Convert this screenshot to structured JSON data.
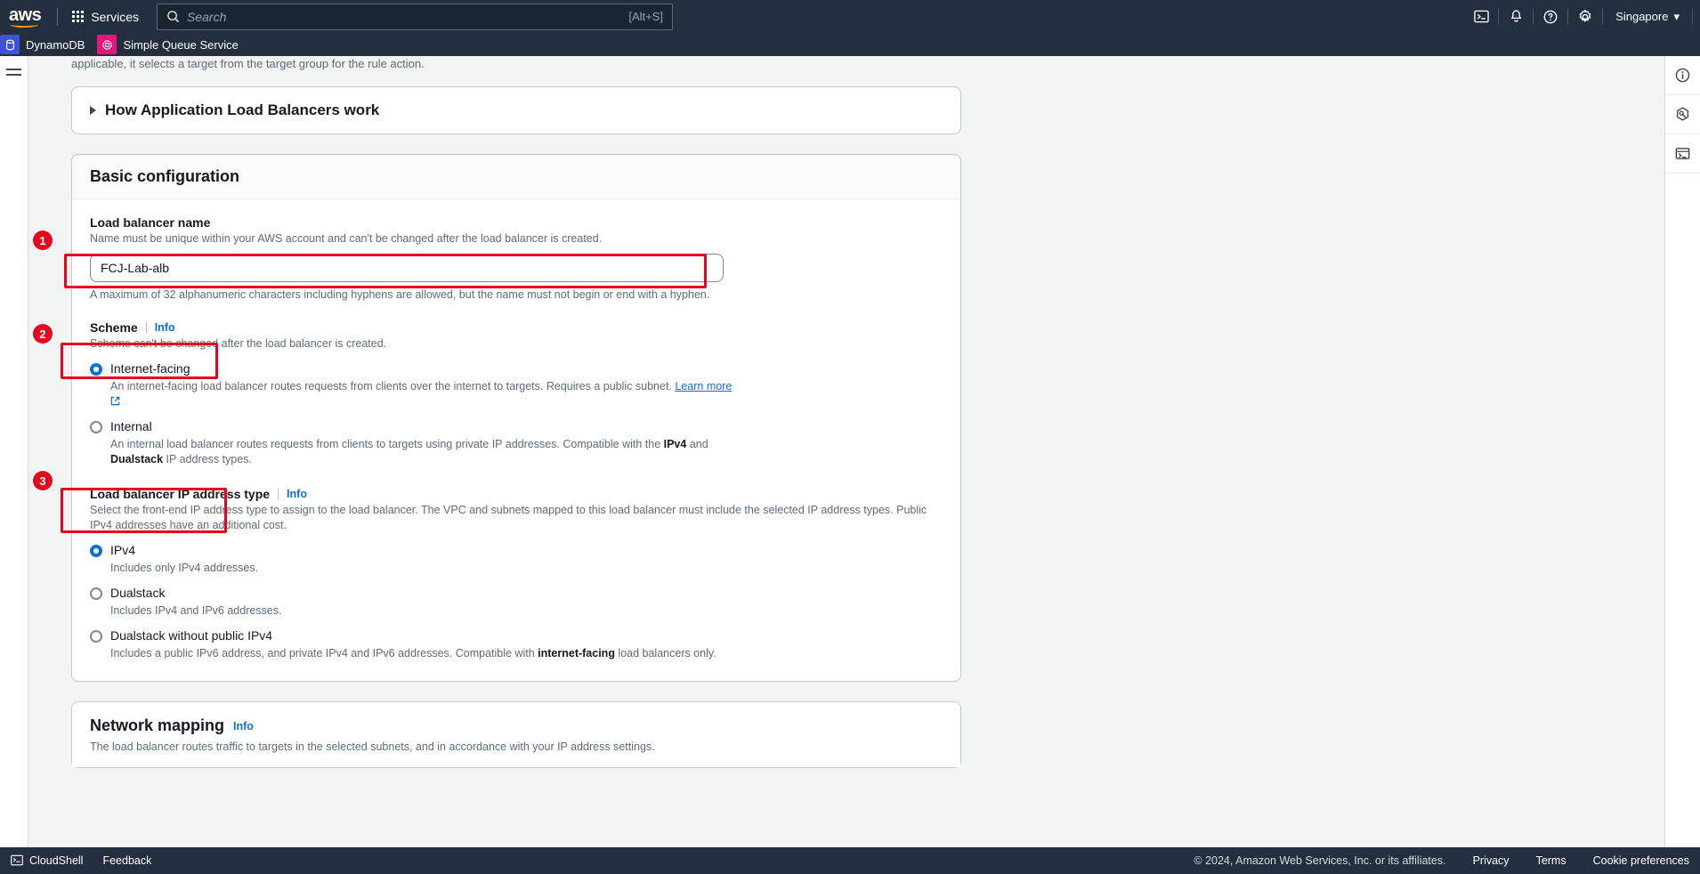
{
  "topnav": {
    "logo": "aws",
    "services_label": "Services",
    "search_placeholder": "Search",
    "search_shortcut": "[Alt+S]",
    "region": "Singapore",
    "region_caret": "▾",
    "icons": [
      "cloudshell-icon",
      "notifications-bell-icon",
      "help-question-icon",
      "settings-gear-icon"
    ]
  },
  "favorites": [
    {
      "label": "DynamoDB",
      "glyph": "☲"
    },
    {
      "label": "Simple Queue Service",
      "glyph": "☉"
    }
  ],
  "truncated_text": "applicable, it selects a target from the target group for the rule action.",
  "expandable": {
    "title": "How Application Load Balancers work"
  },
  "basic_configuration": {
    "title": "Basic configuration",
    "name_field": {
      "label": "Load balancer name",
      "description": "Name must be unique within your AWS account and can't be changed after the load balancer is created.",
      "value": "FCJ-Lab-alb",
      "constraint": "A maximum of 32 alphanumeric characters including hyphens are allowed, but the name must not begin or end with a hyphen."
    },
    "scheme": {
      "label": "Scheme",
      "info": "Info",
      "description": "Scheme can't be changed after the load balancer is created.",
      "options": [
        {
          "label": "Internet-facing",
          "desc_pre": "An internet-facing load balancer routes requests from clients over the internet to targets. Requires a public subnet. ",
          "link": "Learn more",
          "selected": true
        },
        {
          "label": "Internal",
          "desc_pre": "An internal load balancer routes requests from clients to targets using private IP addresses. Compatible with the ",
          "bold1": "IPv4",
          "desc_mid": " and ",
          "bold2": "Dualstack",
          "desc_post": " IP address types.",
          "selected": false
        }
      ]
    },
    "ip_address_type": {
      "label": "Load balancer IP address type",
      "info": "Info",
      "description": "Select the front-end IP address type to assign to the load balancer. The VPC and subnets mapped to this load balancer must include the selected IP address types. Public IPv4 addresses have an additional cost.",
      "options": [
        {
          "label": "IPv4",
          "desc": "Includes only IPv4 addresses.",
          "selected": true
        },
        {
          "label": "Dualstack",
          "desc": "Includes IPv4 and IPv6 addresses.",
          "selected": false
        },
        {
          "label": "Dualstack without public IPv4",
          "desc_pre": "Includes a public IPv6 address, and private IPv4 and IPv6 addresses. Compatible with ",
          "bold1": "internet-facing",
          "desc_post": " load balancers only.",
          "selected": false
        }
      ]
    }
  },
  "network_mapping": {
    "title": "Network mapping",
    "info": "Info",
    "description": "The load balancer routes traffic to targets in the selected subnets, and in accordance with your IP address settings."
  },
  "annotations": {
    "badge1": "1",
    "badge2": "2",
    "badge3": "3",
    "color": "#e2071c"
  },
  "footer": {
    "cloudshell": "CloudShell",
    "feedback": "Feedback",
    "copyright": "© 2024, Amazon Web Services, Inc. or its affiliates.",
    "privacy": "Privacy",
    "terms": "Terms",
    "cookie": "Cookie preferences"
  }
}
